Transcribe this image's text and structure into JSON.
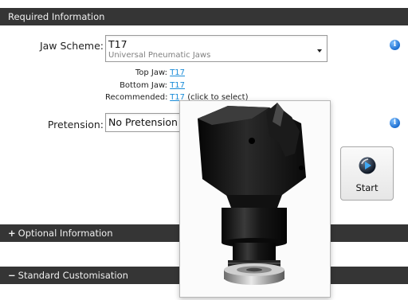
{
  "sections": {
    "required": {
      "title": "Required Information"
    },
    "optional": {
      "toggle": "+",
      "title": "Optional Information"
    },
    "standard": {
      "toggle": "−",
      "title": "Standard Customisation"
    }
  },
  "jaw_scheme": {
    "label": "Jaw Scheme:",
    "value": "T17",
    "description": "Universal Pneumatic Jaws",
    "top_jaw_label": "Top Jaw:",
    "top_jaw_value": "T17",
    "bottom_jaw_label": "Bottom Jaw:",
    "bottom_jaw_value": "T17",
    "recommended_label": "Recommended:",
    "recommended_value": "T17",
    "recommended_hint": " (click to select)"
  },
  "pretension": {
    "label": "Pretension:",
    "value": "No Pretension (",
    "hint": ")"
  },
  "start_button": {
    "label": "Start"
  },
  "icons": {
    "info": "info-icon",
    "dropdown": "chevron-down-icon",
    "start": "play-icon"
  },
  "colors": {
    "section_bar": "#353535",
    "link": "#1a8cd8",
    "info_blue": "#1e6fd0"
  }
}
